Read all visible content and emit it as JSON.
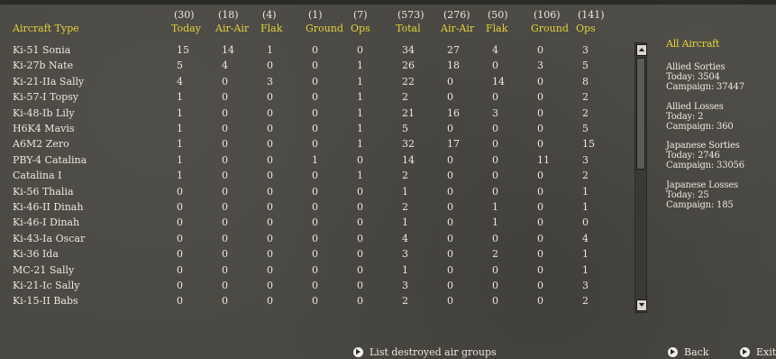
{
  "columns": [
    {
      "count": "(30)",
      "label": "Today"
    },
    {
      "count": "(18)",
      "label": "Air-Air"
    },
    {
      "count": "(4)",
      "label": "Flak"
    },
    {
      "count": "(1)",
      "label": "Ground"
    },
    {
      "count": "(7)",
      "label": "Ops"
    },
    {
      "count": "(573)",
      "label": "Total"
    },
    {
      "count": "(276)",
      "label": "Air-Air"
    },
    {
      "count": "(50)",
      "label": "Flak"
    },
    {
      "count": "(106)",
      "label": "Ground"
    },
    {
      "count": "(141)",
      "label": "Ops"
    }
  ],
  "type_header": "Aircraft Type",
  "rows": [
    [
      "Ki-51 Sonia",
      "15",
      "14",
      "1",
      "0",
      "0",
      "34",
      "27",
      "4",
      "0",
      "3"
    ],
    [
      "Ki-27b Nate",
      "5",
      "4",
      "0",
      "0",
      "1",
      "26",
      "18",
      "0",
      "3",
      "5"
    ],
    [
      "Ki-21-IIa Sally",
      "4",
      "0",
      "3",
      "0",
      "1",
      "22",
      "0",
      "14",
      "0",
      "8"
    ],
    [
      "Ki-57-I Topsy",
      "1",
      "0",
      "0",
      "0",
      "1",
      "2",
      "0",
      "0",
      "0",
      "2"
    ],
    [
      "Ki-48-Ib Lily",
      "1",
      "0",
      "0",
      "0",
      "1",
      "21",
      "16",
      "3",
      "0",
      "2"
    ],
    [
      "H6K4 Mavis",
      "1",
      "0",
      "0",
      "0",
      "1",
      "5",
      "0",
      "0",
      "0",
      "5"
    ],
    [
      "A6M2 Zero",
      "1",
      "0",
      "0",
      "0",
      "1",
      "32",
      "17",
      "0",
      "0",
      "15"
    ],
    [
      "PBY-4 Catalina",
      "1",
      "0",
      "0",
      "1",
      "0",
      "14",
      "0",
      "0",
      "11",
      "3"
    ],
    [
      "Catalina I",
      "1",
      "0",
      "0",
      "0",
      "1",
      "2",
      "0",
      "0",
      "0",
      "2"
    ],
    [
      "Ki-56 Thalia",
      "0",
      "0",
      "0",
      "0",
      "0",
      "1",
      "0",
      "0",
      "0",
      "1"
    ],
    [
      "Ki-46-II Dinah",
      "0",
      "0",
      "0",
      "0",
      "0",
      "2",
      "0",
      "1",
      "0",
      "1"
    ],
    [
      "Ki-46-I Dinah",
      "0",
      "0",
      "0",
      "0",
      "0",
      "1",
      "0",
      "1",
      "0",
      "0"
    ],
    [
      "Ki-43-Ia Oscar",
      "0",
      "0",
      "0",
      "0",
      "0",
      "4",
      "0",
      "0",
      "0",
      "4"
    ],
    [
      "Ki-36 Ida",
      "0",
      "0",
      "0",
      "0",
      "0",
      "3",
      "0",
      "2",
      "0",
      "1"
    ],
    [
      "MC-21 Sally",
      "0",
      "0",
      "0",
      "0",
      "0",
      "1",
      "0",
      "0",
      "0",
      "1"
    ],
    [
      "Ki-21-Ic Sally",
      "0",
      "0",
      "0",
      "0",
      "0",
      "3",
      "0",
      "0",
      "0",
      "3"
    ],
    [
      "Ki-15-II Babs",
      "0",
      "0",
      "0",
      "0",
      "0",
      "2",
      "0",
      "0",
      "0",
      "2"
    ]
  ],
  "summary": {
    "title": "All Aircraft",
    "allied_sorties": {
      "heading": "Allied Sorties",
      "today": "Today:  3504",
      "campaign": "Campaign: 37447"
    },
    "allied_losses": {
      "heading": "Allied Losses",
      "today": "Today:  2",
      "campaign": "Campaign: 360"
    },
    "japanese_sorties": {
      "heading": "Japanese Sorties",
      "today": "Today:  2746",
      "campaign": "Campaign: 33056"
    },
    "japanese_losses": {
      "heading": "Japanese Losses",
      "today": "Today:  25",
      "campaign": "Campaign: 185"
    }
  },
  "buttons": {
    "list_destroyed": "List destroyed air groups",
    "back": "Back",
    "exit": "Exit"
  },
  "colors": {
    "background": "#4a4843",
    "header_yellow": "#e2d23a",
    "text": "#ece7da"
  }
}
